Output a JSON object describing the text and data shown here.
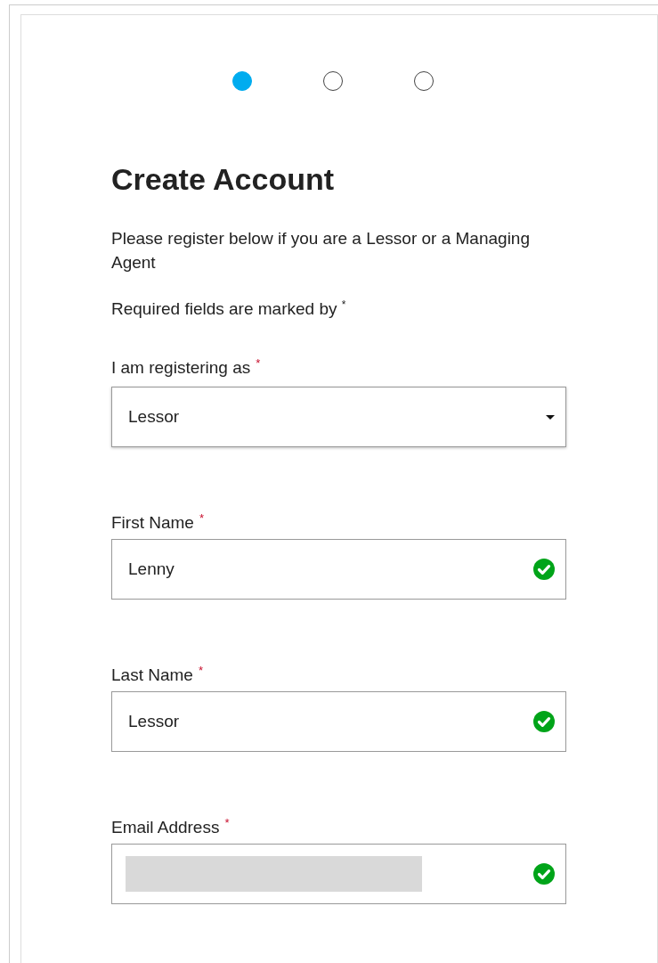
{
  "steps": [
    {
      "selected": true
    },
    {
      "selected": false
    },
    {
      "selected": false
    }
  ],
  "title": "Create Account",
  "intro": "Please register below if you are a Lessor or a Managing Agent",
  "required_note": "Required fields are marked by $^{*}$",
  "fields": [
    {
      "kind": "select",
      "label": "I am registering as",
      "required_mark": "*",
      "value": "Lessor"
    },
    {
      "kind": "text",
      "label": "First Name",
      "required_mark": "*",
      "value": "Lenny",
      "valid": true
    },
    {
      "kind": "text",
      "label": "Last Name",
      "required_mark": "*",
      "value": "Lessor",
      "valid": true
    },
    {
      "kind": "text",
      "label": "Email Address",
      "required_mark": "*",
      "valid": true,
      "redacted": true
    }
  ]
}
